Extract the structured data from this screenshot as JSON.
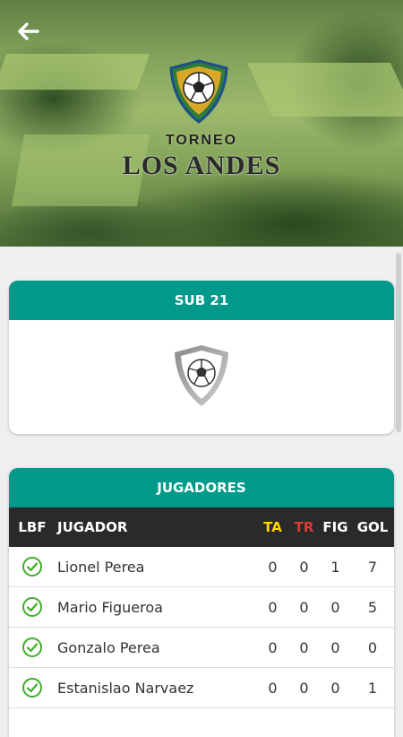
{
  "header": {
    "back_icon": "arrow-left-icon",
    "logo": {
      "line1": "TORNEO",
      "line2": "LOS ANDES"
    }
  },
  "category_card": {
    "title": "SUB 21",
    "crest_icon": "soccer-ball-shield-icon"
  },
  "players_card": {
    "title": "JUGADORES",
    "columns": {
      "lbf": "LBF",
      "player": "JUGADOR",
      "ta": "TA",
      "tr": "TR",
      "fig": "FIG",
      "gol": "GOL"
    },
    "rows": [
      {
        "verified_icon": "check-circle-icon",
        "name": "Lionel Perea",
        "ta": "0",
        "tr": "0",
        "fig": "1",
        "gol": "7"
      },
      {
        "verified_icon": "check-circle-icon",
        "name": "Mario Figueroa",
        "ta": "0",
        "tr": "0",
        "fig": "0",
        "gol": "5"
      },
      {
        "verified_icon": "check-circle-icon",
        "name": "Gonzalo Perea",
        "ta": "0",
        "tr": "0",
        "fig": "0",
        "gol": "0"
      },
      {
        "verified_icon": "check-circle-icon",
        "name": "Estanislao Narvaez",
        "ta": "0",
        "tr": "0",
        "fig": "0",
        "gol": "1"
      }
    ]
  },
  "colors": {
    "accent": "#00998a",
    "table_header": "#2a2a2a",
    "yellow_card": "#ffd600",
    "red_card": "#e53935",
    "check": "#3fae2a"
  }
}
